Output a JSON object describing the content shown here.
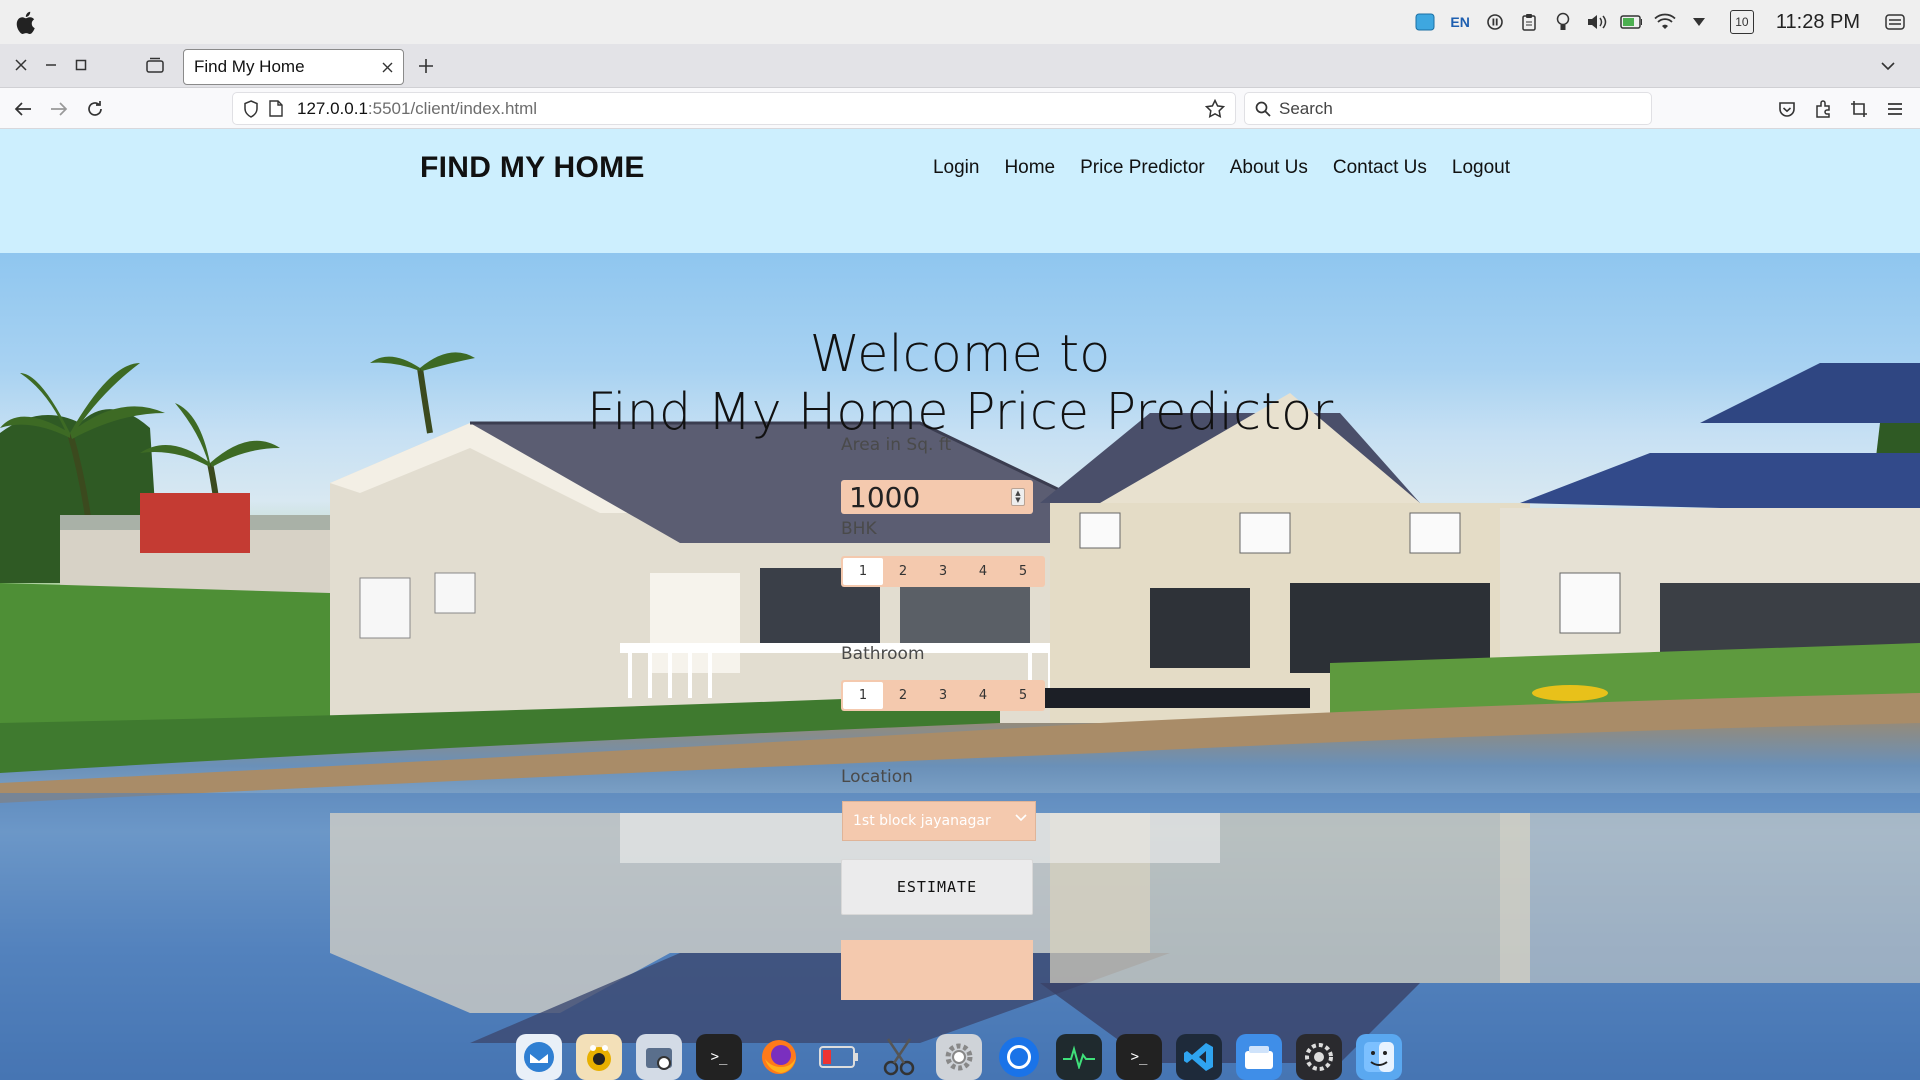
{
  "system": {
    "language": "EN",
    "calendar_day": "10",
    "clock": "11:28 PM"
  },
  "browser": {
    "tab_title": "Find My Home",
    "url_host": "127.0.0.1",
    "url_path": ":5501/client/index.html",
    "search_placeholder": "Search"
  },
  "site": {
    "brand": "FIND MY HOME",
    "nav": [
      "Login",
      "Home",
      "Price Predictor",
      "About Us",
      "Contact Us",
      "Logout"
    ]
  },
  "hero": {
    "title_line1": "Welcome to",
    "title_line2": "Find My Home Price Predictor"
  },
  "form": {
    "area_label": "Area in Sq. ft",
    "area_value": "1000",
    "bhk_label": "BHK",
    "bhk_options": [
      "1",
      "2",
      "3",
      "4",
      "5"
    ],
    "bhk_selected": "1",
    "bath_label": "Bathroom",
    "bath_options": [
      "1",
      "2",
      "3",
      "4",
      "5"
    ],
    "bath_selected": "1",
    "location_label": "Location",
    "location_value": "1st block jayanagar",
    "estimate_label": "ESTIMATE"
  },
  "colors": {
    "header_bg": "#cdeffe",
    "form_accent": "#f4c9ae"
  },
  "dock": [
    "thunderbird-icon",
    "photo-booth-icon",
    "screenshot-icon",
    "terminal-icon",
    "firefox-icon",
    "battery-app-icon",
    "scissors-icon",
    "settings-icon",
    "chrome-icon",
    "activity-monitor-icon",
    "terminal2-icon",
    "vscode-icon",
    "app-store-icon",
    "system-preferences-icon",
    "finder-icon"
  ]
}
